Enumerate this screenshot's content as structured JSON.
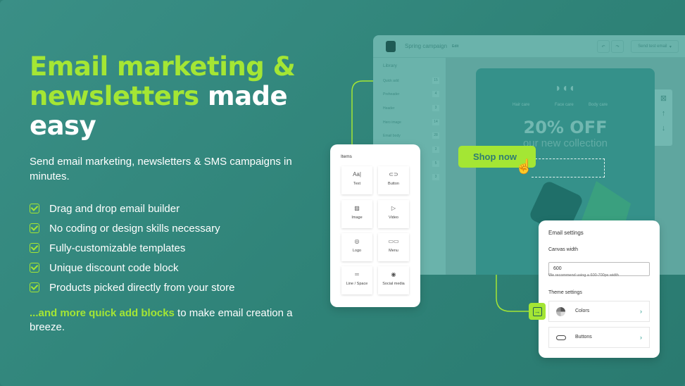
{
  "hero": {
    "title_hl": "Email marketing & newsletters",
    "title_rest": " made easy",
    "subtitle": "Send email marketing, newsletters & SMS campaigns in minutes.",
    "features": [
      "Drag and drop email builder",
      "No coding or design skills necessary",
      "Fully-customizable templates",
      "Unique discount code block",
      "Products picked directly from your store"
    ],
    "more_hl": "...and more quick add blocks",
    "more_rest": " to make email creation a breeze."
  },
  "editor": {
    "title": "Spring campaign",
    "edit": "Edit",
    "send": "Send test email",
    "library": "Library",
    "library_items": [
      {
        "label": "Quick add",
        "count": "15"
      },
      {
        "label": "Preheader",
        "count": "4"
      },
      {
        "label": "Header",
        "count": "3"
      },
      {
        "label": "Hero image",
        "count": "14"
      },
      {
        "label": "Email body",
        "count": "28"
      }
    ],
    "library_counts_extra": [
      "3",
      "5",
      "3"
    ],
    "nav": [
      "Hair care",
      "Face care",
      "Body care"
    ],
    "headline": "20% OFF",
    "tagline": "our new collection",
    "shop": "Shop now"
  },
  "items_panel": {
    "title": "Items",
    "tiles": [
      {
        "icon": "Aa|",
        "label": "Text"
      },
      {
        "icon": "⊂⊃",
        "label": "Button"
      },
      {
        "icon": "▨",
        "label": "Image"
      },
      {
        "icon": "▷",
        "label": "Video"
      },
      {
        "icon": "◎",
        "label": "Logo"
      },
      {
        "icon": "▭▭",
        "label": "Menu"
      },
      {
        "icon": "═",
        "label": "Line / Space"
      },
      {
        "icon": "◉",
        "label": "Social media"
      }
    ]
  },
  "settings": {
    "title": "Email settings",
    "canvas_label": "Canvas width",
    "canvas_value": "600",
    "hint": "We recommend using a 600-700px width",
    "theme": "Theme settings",
    "rows": [
      {
        "label": "Colors",
        "icon": "pie-icon"
      },
      {
        "label": "Buttons",
        "icon": "button-icon"
      }
    ]
  },
  "colors": {
    "accent": "#a4e634",
    "bg": "#2f8378"
  }
}
